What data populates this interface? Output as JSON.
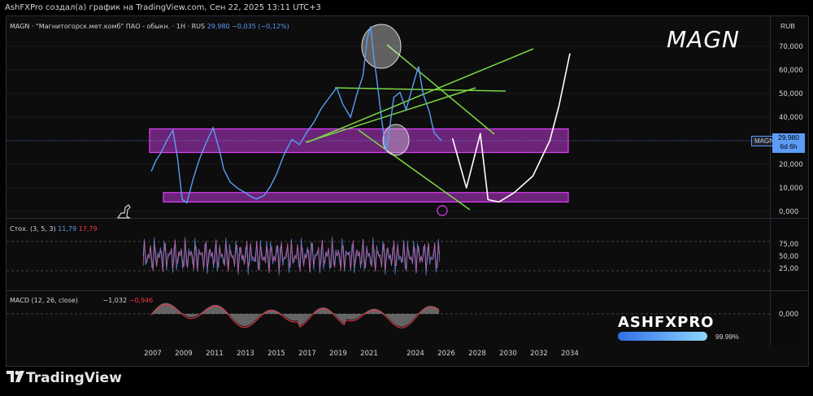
{
  "header": {
    "caption": "AshFXPro создал(а) график на TradingView.com, Сен 22, 2025 13:11 UTC+3"
  },
  "main_pane": {
    "legend_symbol": "MAGN · \"Магнитогорск.мет.комб\" ПАО - обыкн. · 1H · RUS",
    "legend_price": "29,980",
    "legend_change": "−0,035 (−0,12%)",
    "currency": "RUB",
    "symbol_badge": "MAGN",
    "price_badge_value": "29,980",
    "price_badge_countdown": "6d 6h",
    "annotation_title": "MAGN"
  },
  "stoch_pane": {
    "label": "Стох. (3, 5, 3)",
    "k_value": "11,79",
    "d_value": "17,79"
  },
  "macd_pane": {
    "label": "MACD (12, 26, close)",
    "value_1": "−1,032",
    "value_2": "−0,946"
  },
  "watermark": {
    "brand": "ASHFXPRO",
    "percent": "99.99%"
  },
  "footer": {
    "logo_text": "TradingView"
  },
  "colors": {
    "price_line": "#5b9cf6",
    "zone": "#e040fb",
    "trendline": "#7cd943",
    "stoch": "#c462a8",
    "macd_fill": "#9e9e9e",
    "macd_line": "#f23645",
    "background": "#0d0d0d"
  },
  "chart_data": [
    {
      "type": "line",
      "title": "MAGN",
      "series": [
        {
          "name": "MAGN",
          "x": [
            2006.9,
            2007.2,
            2007.5,
            2007.9,
            2008.3,
            2008.6,
            2008.9,
            2009.2,
            2009.6,
            2010.0,
            2010.4,
            2010.9,
            2011.3,
            2011.6,
            2012.0,
            2012.5,
            2012.9,
            2013.3,
            2013.7,
            2014.2,
            2014.6,
            2015.0,
            2015.5,
            2016.0,
            2016.5,
            2017.0,
            2017.4,
            2017.9,
            2018.4,
            2018.9,
            2019.3,
            2019.8,
            2020.2,
            2020.6,
            2020.9,
            2021.1,
            2021.3,
            2021.5,
            2021.8,
            2022.1,
            2022.3,
            2022.6,
            2023.0,
            2023.4,
            2023.8,
            2024.2,
            2024.5,
            2024.9,
            2025.2,
            2025.5,
            2025.7
          ],
          "y": [
            17,
            22,
            25,
            30,
            34,
            22,
            5,
            4,
            14,
            22,
            28,
            35,
            26,
            18,
            13,
            10,
            8,
            6,
            5,
            7,
            11,
            16,
            24,
            30,
            28,
            34,
            38,
            44,
            48,
            52,
            45,
            40,
            50,
            58,
            74,
            78,
            65,
            56,
            40,
            26,
            34,
            48,
            50,
            43,
            53,
            62,
            50,
            42,
            33,
            31,
            30
          ]
        }
      ],
      "xticks": [
        "2007",
        "2009",
        "2011",
        "2013",
        "2015",
        "2017",
        "2019",
        "2021",
        "2024",
        "2026",
        "2028",
        "2030",
        "2032",
        "2034"
      ],
      "yticks": [
        "0,000",
        "10,000",
        "20,000",
        "30,000",
        "40,000",
        "50,000",
        "60,000",
        "70,000"
      ],
      "ylim": [
        0,
        72
      ],
      "zones": [
        {
          "from": 25,
          "to": 35
        },
        {
          "from": 4,
          "to": 8
        }
      ],
      "projection": {
        "x": [
          2026.4,
          2027.3,
          2028.2,
          2028.7,
          2029.4,
          2030.4,
          2031.6,
          2032.7,
          2033.3,
          2034.0
        ],
        "y": [
          31,
          10,
          33,
          5,
          4,
          8,
          15,
          30,
          45,
          67
        ]
      }
    },
    {
      "type": "line",
      "title": "Стох. (3, 5, 3)",
      "yticks": [
        "25,00",
        "50,00",
        "75,00"
      ],
      "ylim": [
        0,
        100
      ]
    },
    {
      "type": "area",
      "title": "MACD (12, 26, close)",
      "yticks": [
        "0,000"
      ]
    }
  ]
}
